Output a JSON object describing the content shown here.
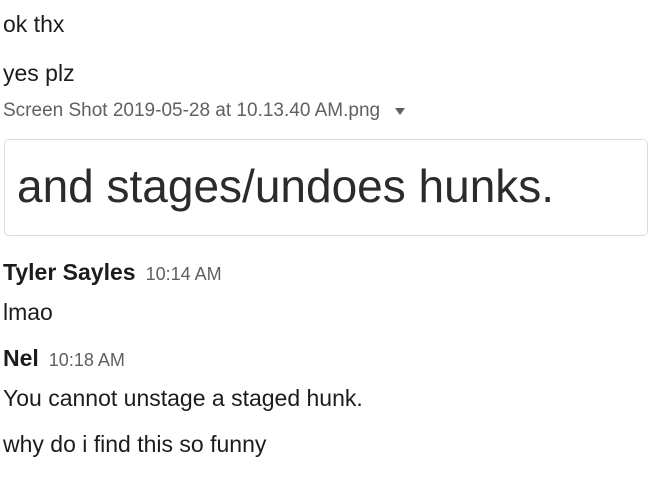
{
  "messages_top": [
    {
      "text": "ok thx"
    },
    {
      "text": "yes plz"
    }
  ],
  "file": {
    "name": "Screen Shot 2019-05-28 at 10.13.40 AM.png",
    "caret_icon": "caret-down-icon",
    "preview_text": "and stages/undoes hunks."
  },
  "groups": [
    {
      "sender": "Tyler Sayles",
      "time": "10:14 AM",
      "messages": [
        "lmao"
      ]
    },
    {
      "sender": "Nel",
      "time": "10:18 AM",
      "messages": [
        "You cannot unstage a staged hunk.",
        "why do i find this so funny"
      ]
    }
  ],
  "colors": {
    "text": "#1d1c1d",
    "muted": "#616061",
    "border": "#dcdcdc"
  }
}
